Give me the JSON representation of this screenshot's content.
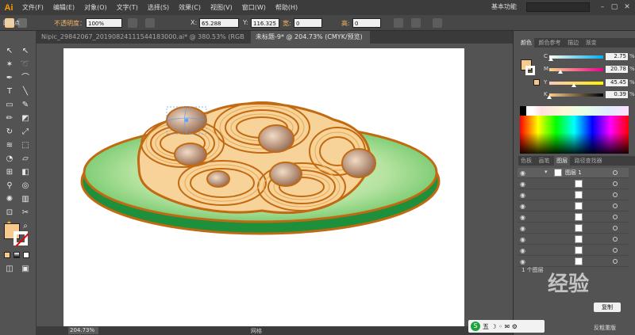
{
  "app": {
    "logo": "Ai",
    "workspace": "基本功能"
  },
  "menu": [
    "文件(F)",
    "编辑(E)",
    "对象(O)",
    "文字(T)",
    "选择(S)",
    "效果(C)",
    "视图(V)",
    "窗口(W)",
    "帮助(H)"
  ],
  "control": {
    "opacity_label": "不透明度：",
    "opacity_value": "100%",
    "x_label": "X:",
    "x_value": "65.288",
    "y_label": "Y:",
    "y_value": "116.325",
    "w_label": "宽:",
    "w_value": "0",
    "h_label": "高:",
    "h_value": "0"
  },
  "toolbox_title": "网格点",
  "tabs": [
    {
      "label": "Nipic_29842067_20190824111544183000.ai* @ 380.53% (RGB/预览)",
      "active": false
    },
    {
      "label": "未标题-9* @ 204.73% (CMYK/预览)",
      "active": true
    }
  ],
  "status": {
    "zoom": "204.73%",
    "tool": "网格"
  },
  "color_panel": {
    "tabs": [
      "颜色",
      "颜色参考",
      "描边",
      "渐变"
    ],
    "channels": [
      {
        "label": "C",
        "value": "2.75",
        "unit": "%",
        "level": 0.03,
        "gradient": "linear-gradient(to right,#fff9ec,#00aeef)"
      },
      {
        "label": "M",
        "value": "20.78",
        "unit": "%",
        "level": 0.21,
        "gradient": "linear-gradient(to right,#f7d38a,#ec008c)"
      },
      {
        "label": "Y",
        "value": "45.45",
        "unit": "%",
        "level": 0.45,
        "gradient": "linear-gradient(to right,#f9c8c0,#fff200)"
      },
      {
        "label": "K",
        "value": "0.39",
        "unit": "%",
        "level": 0.004,
        "gradient": "linear-gradient(to right,#f8cf8e,#000)"
      }
    ],
    "fill_color": "#f7c98d"
  },
  "layers_panel": {
    "tabs": [
      "色板",
      "画笔",
      "图层",
      "路径查找器"
    ],
    "layer_name": "图层 1",
    "footer": "1 个图层"
  },
  "overlay": {
    "watermark": "经验",
    "button": "复制",
    "small_text": "反粗重版"
  }
}
